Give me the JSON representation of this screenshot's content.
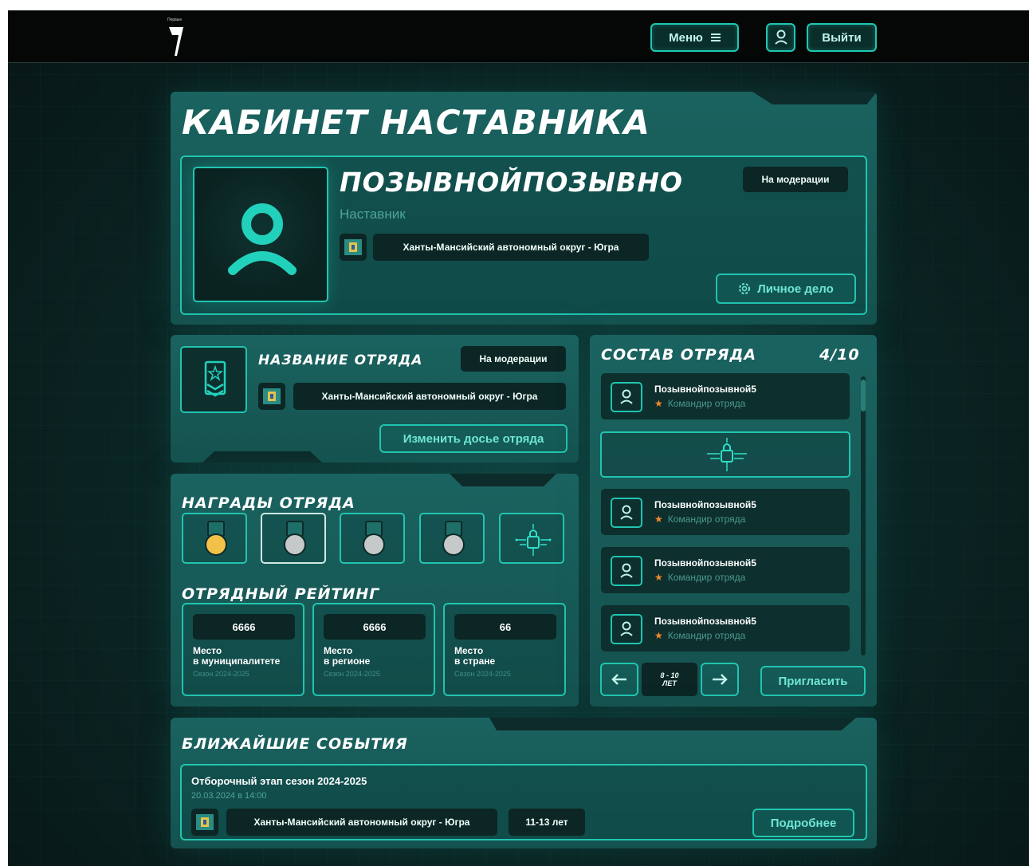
{
  "header": {
    "logo_small_text": "Первые",
    "menu_label": "Меню",
    "exit_label": "Выйти"
  },
  "cabinet": {
    "title": "КАБИНЕТ НАСТАВНИКА",
    "profile": {
      "callsign": "ПОЗЫВНОЙПОЗЫВНО",
      "status": "На модерации",
      "role": "Наставник",
      "region": "Ханты-Мансийский автономный округ - Югра",
      "personal_file_button": "Личное дело"
    }
  },
  "squad": {
    "name": "НАЗВАНИЕ ОТРЯДА",
    "status": "На модерации",
    "region": "Ханты-Мансийский автономный округ - Югра",
    "edit_button": "Изменить досье отряда"
  },
  "awards": {
    "title": "НАГРАДЫ ОТРЯДА",
    "medals": [
      {
        "type": "gold",
        "color": "#f2c14a",
        "selected": false
      },
      {
        "type": "silver",
        "color": "#c6c9c9",
        "selected": true
      },
      {
        "type": "silver",
        "color": "#c6c9c9",
        "selected": false
      },
      {
        "type": "silver",
        "color": "#c6c9c9",
        "selected": false
      },
      {
        "type": "locked",
        "icon": "lock-icon"
      }
    ]
  },
  "rating": {
    "title": "ОТРЯДНЫЙ РЕЙТИНГ",
    "items": [
      {
        "value": "6666",
        "label_line1": "Место",
        "label_line2": "в муниципалитете",
        "season": "Сезон 2024-2025"
      },
      {
        "value": "6666",
        "label_line1": "Место",
        "label_line2": "в регионе",
        "season": "Сезон 2024-2025"
      },
      {
        "value": "66",
        "label_line1": "Место",
        "label_line2": "в стране",
        "season": "Сезон 2024-2025"
      }
    ]
  },
  "roster": {
    "title": "СОСТАВ ОТРЯДА",
    "count": "4/10",
    "members": [
      {
        "name": "Позывнойпозывной5",
        "role": "Командир отряда"
      },
      {
        "name": "Позывнойпозывной5",
        "role": "Командир отряда"
      },
      {
        "name": "Позывнойпозывной5",
        "role": "Командир отряда"
      },
      {
        "name": "Позывнойпозывной5",
        "role": "Командир отряда"
      }
    ],
    "age_line1": "8 - 10",
    "age_line2": "ЛЕТ",
    "invite_button": "Пригласить"
  },
  "events": {
    "title": "БЛИЖАЙШИЕ СОБЫТИЯ",
    "items": [
      {
        "name": "Отборочный этап сезон 2024-2025",
        "datetime": "20.03.2024 в 14:00",
        "region": "Ханты-Мансийский автономный округ - Югра",
        "age": "11-13 лет",
        "details_button": "Подробнее"
      }
    ]
  },
  "colors": {
    "accent": "#20c5b0",
    "panel": "#1a6360",
    "dark": "#0b2624",
    "star": "#f08a2a"
  }
}
